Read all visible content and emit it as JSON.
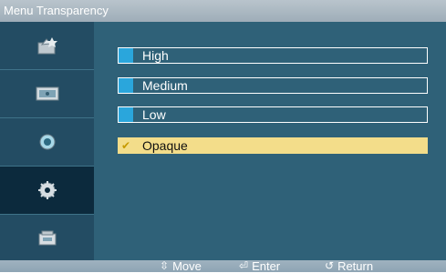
{
  "title": "Menu Transparency",
  "sidebar": {
    "items": [
      {
        "icon": "picture-icon"
      },
      {
        "icon": "sound-icon"
      },
      {
        "icon": "channel-icon"
      },
      {
        "icon": "setup-icon",
        "selected": true
      },
      {
        "icon": "input-icon"
      }
    ]
  },
  "options": [
    {
      "label": "High"
    },
    {
      "label": "Medium"
    },
    {
      "label": "Low"
    },
    {
      "label": "Opaque",
      "selected": true
    }
  ],
  "footer": {
    "move": {
      "icon": "updown-arrows-icon",
      "label": "Move"
    },
    "enter": {
      "icon": "enter-icon",
      "label": "Enter"
    },
    "return": {
      "icon": "return-icon",
      "label": "Return"
    }
  },
  "colors": {
    "background": "#2f6178",
    "sidebar": "#234c63",
    "selected_sidebar": "#0c2a3d",
    "highlight": "#f3dd8a",
    "swatch": "#2aa6dc"
  }
}
